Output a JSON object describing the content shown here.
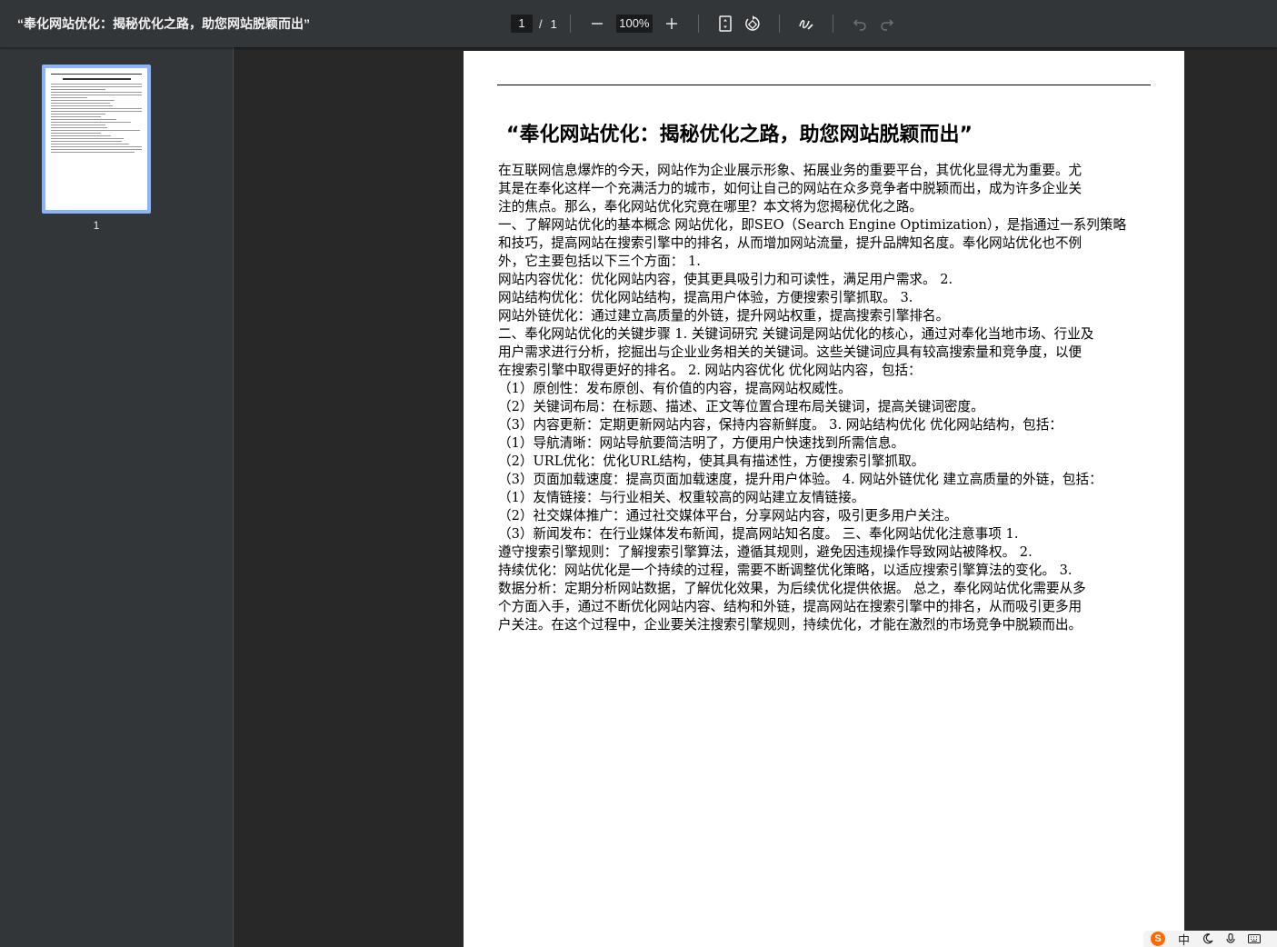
{
  "toolbar": {
    "title": "“奉化网站优化：揭秘优化之路，助您网站脱颖而出”",
    "page_current": "1",
    "page_separator": "/",
    "page_total": "1",
    "zoom": "100%",
    "icons": [
      "minus-icon",
      "plus-icon",
      "fit-page-icon",
      "rotate-icon",
      "draw-icon",
      "undo-icon",
      "redo-icon"
    ]
  },
  "sidebar": {
    "thumbnails": [
      {
        "label": "1"
      }
    ]
  },
  "document": {
    "heading": "“奉化网站优化：揭秘优化之路，助您网站脱颖而出”",
    "lines": [
      "在互联网信息爆炸的今天，网站作为企业展示形象、拓展业务的重要平台，其优化显得尤为重要。尤",
      "其是在奉化这样一个充满活力的城市，如何让自己的网站在众多竞争者中脱颖而出，成为许多企业关",
      "注的焦点。那么，奉化网站优化究竟在哪里？本文将为您揭秘优化之路。",
      "一、了解网站优化的基本概念 网站优化，即SEO（Search Engine Optimization），是指通过一系列策略",
      "和技巧，提高网站在搜索引擎中的排名，从而增加网站流量，提升品牌知名度。奉化网站优化也不例",
      "外，它主要包括以下三个方面： 1.",
      "网站内容优化：优化网站内容，使其更具吸引力和可读性，满足用户需求。 2.",
      "网站结构优化：优化网站结构，提高用户体验，方便搜索引擎抓取。 3.",
      "网站外链优化：通过建立高质量的外链，提升网站权重，提高搜索引擎排名。",
      "二、奉化网站优化的关键步骤 1. 关键词研究 关键词是网站优化的核心，通过对奉化当地市场、行业及",
      "用户需求进行分析，挖掘出与企业业务相关的关键词。这些关键词应具有较高搜索量和竞争度，以便",
      "在搜索引擎中取得更好的排名。 2. 网站内容优化 优化网站内容，包括：",
      "（1）原创性：发布原创、有价值的内容，提高网站权威性。",
      "（2）关键词布局：在标题、描述、正文等位置合理布局关键词，提高关键词密度。",
      "（3）内容更新：定期更新网站内容，保持内容新鲜度。 3. 网站结构优化 优化网站结构，包括：",
      "（1）导航清晰：网站导航要简洁明了，方便用户快速找到所需信息。",
      "（2）URL优化：优化URL结构，使其具有描述性，方便搜索引擎抓取。",
      "（3）页面加载速度：提高页面加载速度，提升用户体验。 4. 网站外链优化 建立高质量的外链，包括：",
      "（1）友情链接：与行业相关、权重较高的网站建立友情链接。",
      "（2）社交媒体推广：通过社交媒体平台，分享网站内容，吸引更多用户关注。",
      "（3）新闻发布：在行业媒体发布新闻，提高网站知名度。 三、奉化网站优化注意事项 1.",
      "遵守搜索引擎规则：了解搜索引擎算法，遵循其规则，避免因违规操作导致网站被降权。 2.",
      "持续优化：网站优化是一个持续的过程，需要不断调整优化策略，以适应搜索引擎算法的变化。 3.",
      "数据分析：定期分析网站数据，了解优化效果，为后续优化提供依据。 总之，奉化网站优化需要从多",
      "个方面入手，通过不断优化网站内容、结构和外链，提高网站在搜索引擎中的排名，从而吸引更多用",
      "户关注。在这个过程中，企业要关注搜索引擎规则，持续优化，才能在激烈的市场竞争中脱颖而出。"
    ]
  },
  "taskbar": {
    "ime_logo": "S",
    "ime_lang": "中",
    "ime_icons": [
      "moon-icon",
      "mic-icon",
      "keyboard-icon"
    ]
  }
}
